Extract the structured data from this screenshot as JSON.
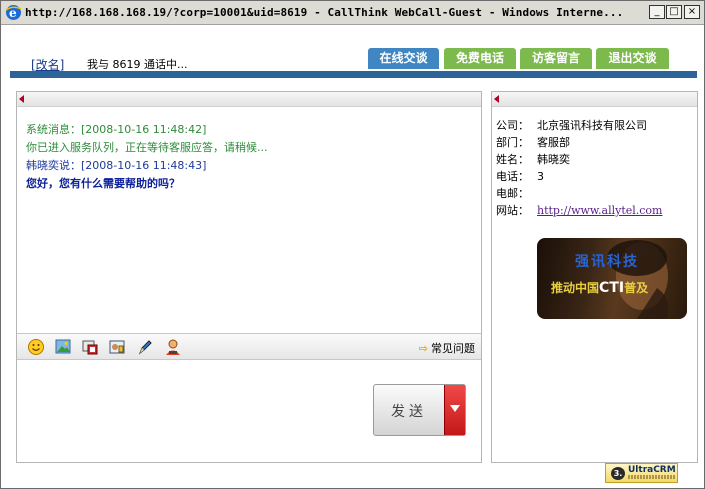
{
  "window": {
    "title": "http://168.168.168.19/?corp=10001&uid=8619 - CallThink WebCall-Guest - Windows Interne...",
    "min_label": "_",
    "max_label": "□",
    "close_label": "×"
  },
  "header": {
    "rename_link": "[改名]",
    "status": "我与 8619 通话中...",
    "tabs": [
      {
        "label": "在线交谈",
        "active": true
      },
      {
        "label": "免费电话",
        "active": false
      },
      {
        "label": "访客留言",
        "active": false
      },
      {
        "label": "退出交谈",
        "active": false
      }
    ]
  },
  "chat": {
    "messages": [
      {
        "text": "系统消息：[2008-10-16 11:48:42]",
        "kind": "system-header"
      },
      {
        "text": "你已进入服务队列，正在等待客服应答，请稍候...",
        "kind": "system-body"
      },
      {
        "text": "韩晓奕说：[2008-10-16 11:48:43]",
        "kind": "agent-header"
      },
      {
        "text": "您好，您有什么需要帮助的吗？",
        "kind": "agent-body"
      }
    ],
    "toolbar_icons": [
      "smiley-icon",
      "image-icon",
      "screenshot-icon",
      "photo-icon",
      "pen-icon",
      "agent-icon"
    ],
    "faq_label": "常见问题",
    "send_label": "发送"
  },
  "info": {
    "rows": [
      {
        "label": "公司：",
        "value": "北京强讯科技有限公司"
      },
      {
        "label": "部门：",
        "value": "客服部"
      },
      {
        "label": "姓名：",
        "value": "韩晓奕"
      },
      {
        "label": "电话：",
        "value": "3"
      },
      {
        "label": "电邮：",
        "value": ""
      },
      {
        "label": "网站：",
        "value": "http://www.allytel.com",
        "link": true
      }
    ],
    "banner": {
      "title": "强讯科技",
      "sub_before": "推动中国",
      "sub_cti": "CTI",
      "sub_after": "普及"
    }
  },
  "footer": {
    "logo_text": "UltraCRM",
    "logo_num": "3."
  },
  "colors": {
    "tab_active": "#3f86c3",
    "tab_inactive": "#7cba4d",
    "header_bar": "#2c6398",
    "system_text": "#2e8b3a",
    "agent_text": "#1f3a9a"
  }
}
